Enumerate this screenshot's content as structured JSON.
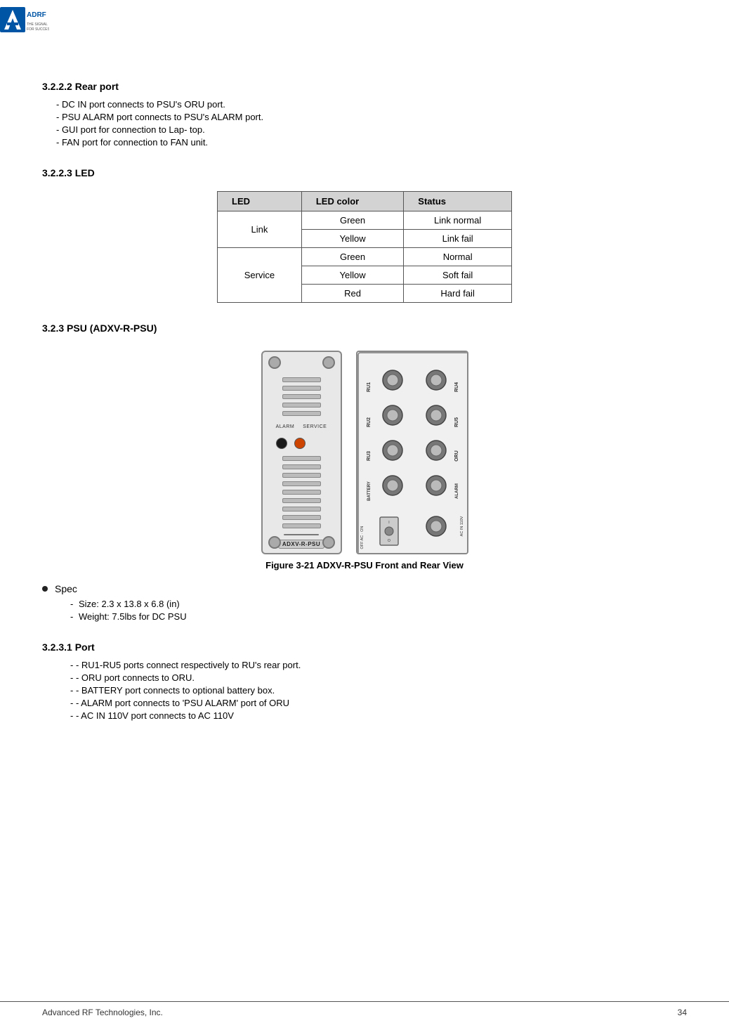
{
  "header": {
    "logo_alt": "ADRF - The Signal for Success"
  },
  "section_322": {
    "heading": "3.2.2.2   Rear port",
    "bullets": [
      "- DC IN port connects to PSU's ORU port.",
      "- PSU ALARM port connects to PSU's ALARM port.",
      "- GUI port for connection to Lap- top.",
      "- FAN port for connection to FAN unit."
    ]
  },
  "section_323": {
    "heading": "3.2.2.3   LED",
    "table": {
      "headers": [
        "LED",
        "LED color",
        "Status"
      ],
      "rows": [
        {
          "led": "Link",
          "color": "Green",
          "status": "Link normal"
        },
        {
          "led": "",
          "color": "Yellow",
          "status": "Link fail"
        },
        {
          "led": "Service",
          "color": "Green",
          "status": "Normal"
        },
        {
          "led": "",
          "color": "Yellow",
          "status": "Soft fail"
        },
        {
          "led": "",
          "color": "Red",
          "status": "Hard fail"
        }
      ]
    }
  },
  "section_323_psu": {
    "heading": "3.2.3     PSU (ADXV-R-PSU)",
    "figure_caption": "Figure 3-21   ADXV-R-PSU Front and Rear View",
    "front_label": "ADXV-R-PSU",
    "rear_labels_left": [
      "OFF",
      "AC - ON",
      "BATTERY",
      "RU3",
      "RU2",
      "RU1"
    ],
    "rear_labels_right": [
      "AC IN 110V",
      "ALARM",
      "ORU",
      "RU5",
      "RU4"
    ],
    "alarm_label": "ALARM",
    "service_label": "SERVICE"
  },
  "spec": {
    "label": "Spec",
    "items": [
      "Size: 2.3 x 13.8 x 6.8 (in)",
      "Weight: 7.5lbs for DC PSU"
    ]
  },
  "section_3231": {
    "heading": "3.2.3.1   Port",
    "bullets": [
      "- RU1-RU5 ports connect respectively to RU's rear port.",
      "- ORU port connects to ORU.",
      "- BATTERY port connects to optional battery box.",
      "- ALARM port connects to 'PSU ALARM' port of ORU",
      "- AC IN 110V port connects to AC 110V"
    ]
  },
  "footer": {
    "left": "Advanced RF Technologies, Inc.",
    "right": "34"
  }
}
